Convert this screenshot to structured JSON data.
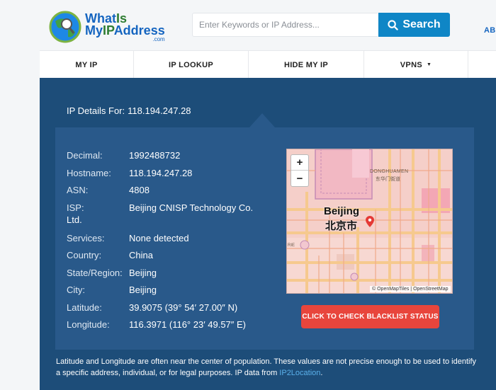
{
  "header": {
    "logo_line1_a": "What",
    "logo_line1_b": "Is",
    "logo_line2_a": "My",
    "logo_line2_b": "IP",
    "logo_line2_c": "Address",
    "logo_com": ".com",
    "search_placeholder": "Enter Keywords or IP Address...",
    "search_button": "Search",
    "cutoff_link": "ABO"
  },
  "nav": {
    "items": [
      {
        "label": "MY IP"
      },
      {
        "label": "IP LOOKUP"
      },
      {
        "label": "HIDE MY IP"
      },
      {
        "label": "VPNS",
        "caret": "▼"
      }
    ]
  },
  "details": {
    "heading_label": "IP Details For:",
    "ip": "118.194.247.28",
    "rows": [
      {
        "key": "Decimal:",
        "value": "1992488732"
      },
      {
        "key": "Hostname:",
        "value": "118.194.247.28"
      },
      {
        "key": "ASN:",
        "value": "4808"
      },
      {
        "key": "ISP:",
        "value": "Beijing CNISP Technology Co.",
        "value_cont": "Ltd."
      },
      {
        "key": "Services:",
        "value": "None detected"
      },
      {
        "key": "Country:",
        "value": "China"
      },
      {
        "key": "State/Region:",
        "value": "Beijing"
      },
      {
        "key": "City:",
        "value": "Beijing"
      },
      {
        "key": "Latitude:",
        "value": "39.9075  (39° 54′ 27.00″ N)"
      },
      {
        "key": "Longitude:",
        "value": "116.3971  (116° 23′ 49.57″ E)"
      }
    ]
  },
  "map": {
    "zoom_in": "+",
    "zoom_out": "−",
    "label_en": "Beijing",
    "label_zh": "北京市",
    "district_en": "DONGHUAMEN",
    "district_zh": "东华门街道",
    "fragment": "RIE",
    "attribution": "© OpenMapTiles | OpenStreetMap"
  },
  "blacklist_button": "CLICK TO CHECK BLACKLIST STATUS",
  "note": {
    "text": "Latitude and Longitude are often near the center of population. These values are not precise enough to be used to identify a specific address, individual, or for legal purposes. IP data from ",
    "link": "IP2Location",
    "end": "."
  },
  "colors": {
    "panel": "#1d4d79",
    "inner_panel": "#29598a",
    "search_button": "#0f86c6",
    "blacklist_button": "#e8453c",
    "link": "#5ab0ea"
  }
}
